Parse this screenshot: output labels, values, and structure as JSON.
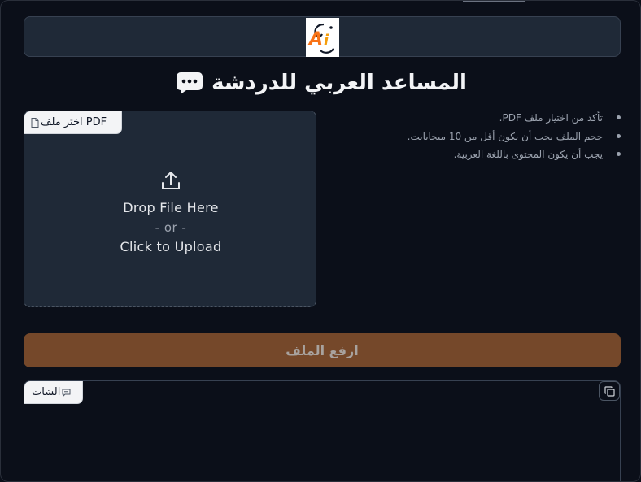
{
  "header": {
    "logo_text": "Ai"
  },
  "title": {
    "text": "المساعد العربي للدردشة",
    "icon": "chat-bubble-dots-icon"
  },
  "upload": {
    "label": "اختر ملف PDF",
    "label_icon": "file-icon",
    "drop_text": "Drop File Here",
    "or_text": "- or -",
    "click_text": "Click to Upload",
    "upload_icon": "upload-icon"
  },
  "notes": {
    "items": [
      "تأكد من اختيار ملف PDF.",
      "حجم الملف يجب أن يكون أقل من 10 ميجابايت.",
      "يجب أن يكون المحتوى باللغة العربية."
    ]
  },
  "upload_button": {
    "label": "ارفع الملف"
  },
  "chat": {
    "label": "الشات",
    "label_icon": "chat-icon",
    "copy_icon": "copy-icon"
  },
  "colors": {
    "background": "#0b0f19",
    "panel": "#1f2937",
    "button": "#75482a",
    "logo_orange": "#f97316"
  }
}
